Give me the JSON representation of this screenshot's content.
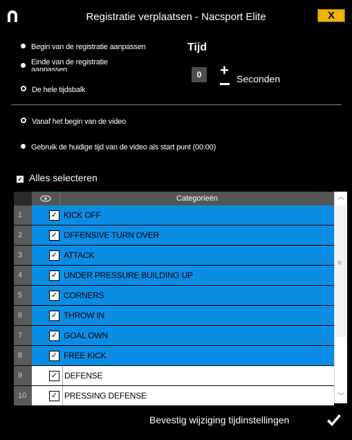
{
  "window": {
    "title": "Registratie verplaatsen - Nacsport Elite",
    "close_label": "X"
  },
  "options": {
    "begin": "Begin van de registratie aanpassen",
    "end_line1": "Einde van de registratie",
    "end_line2": "aanpassen",
    "whole": "De hele tijdsbalk",
    "from_start": "Vanaf het begin van de video",
    "current_time": "Gebruik de huidige tijd van de video als start punt (00:00)"
  },
  "time": {
    "heading": "Tijd",
    "seconds_value": "0",
    "plus": "+",
    "seconds_label": "Seconden"
  },
  "select_all": "Alles selecteren",
  "table": {
    "header": "Categorieën",
    "rows": [
      {
        "num": "1",
        "name": "KICK OFF"
      },
      {
        "num": "2",
        "name": "OFFENSIVE TURN OVER"
      },
      {
        "num": "3",
        "name": "ATTACK"
      },
      {
        "num": "4",
        "name": "UNDER PRESSURE BUILDING UP"
      },
      {
        "num": "5",
        "name": "CORNERS"
      },
      {
        "num": "6",
        "name": "THROW IN"
      },
      {
        "num": "7",
        "name": "GOAL OWN"
      },
      {
        "num": "8",
        "name": "FREE KICK"
      },
      {
        "num": "9",
        "name": "DEFENSE"
      },
      {
        "num": "10",
        "name": "PRESSING DEFENSE"
      }
    ]
  },
  "footer": {
    "confirm_label": "Bevestig wijziging tijdinstellingen"
  },
  "colors": {
    "selected_row": "#0b8de6",
    "close_button": "#f0b400"
  }
}
